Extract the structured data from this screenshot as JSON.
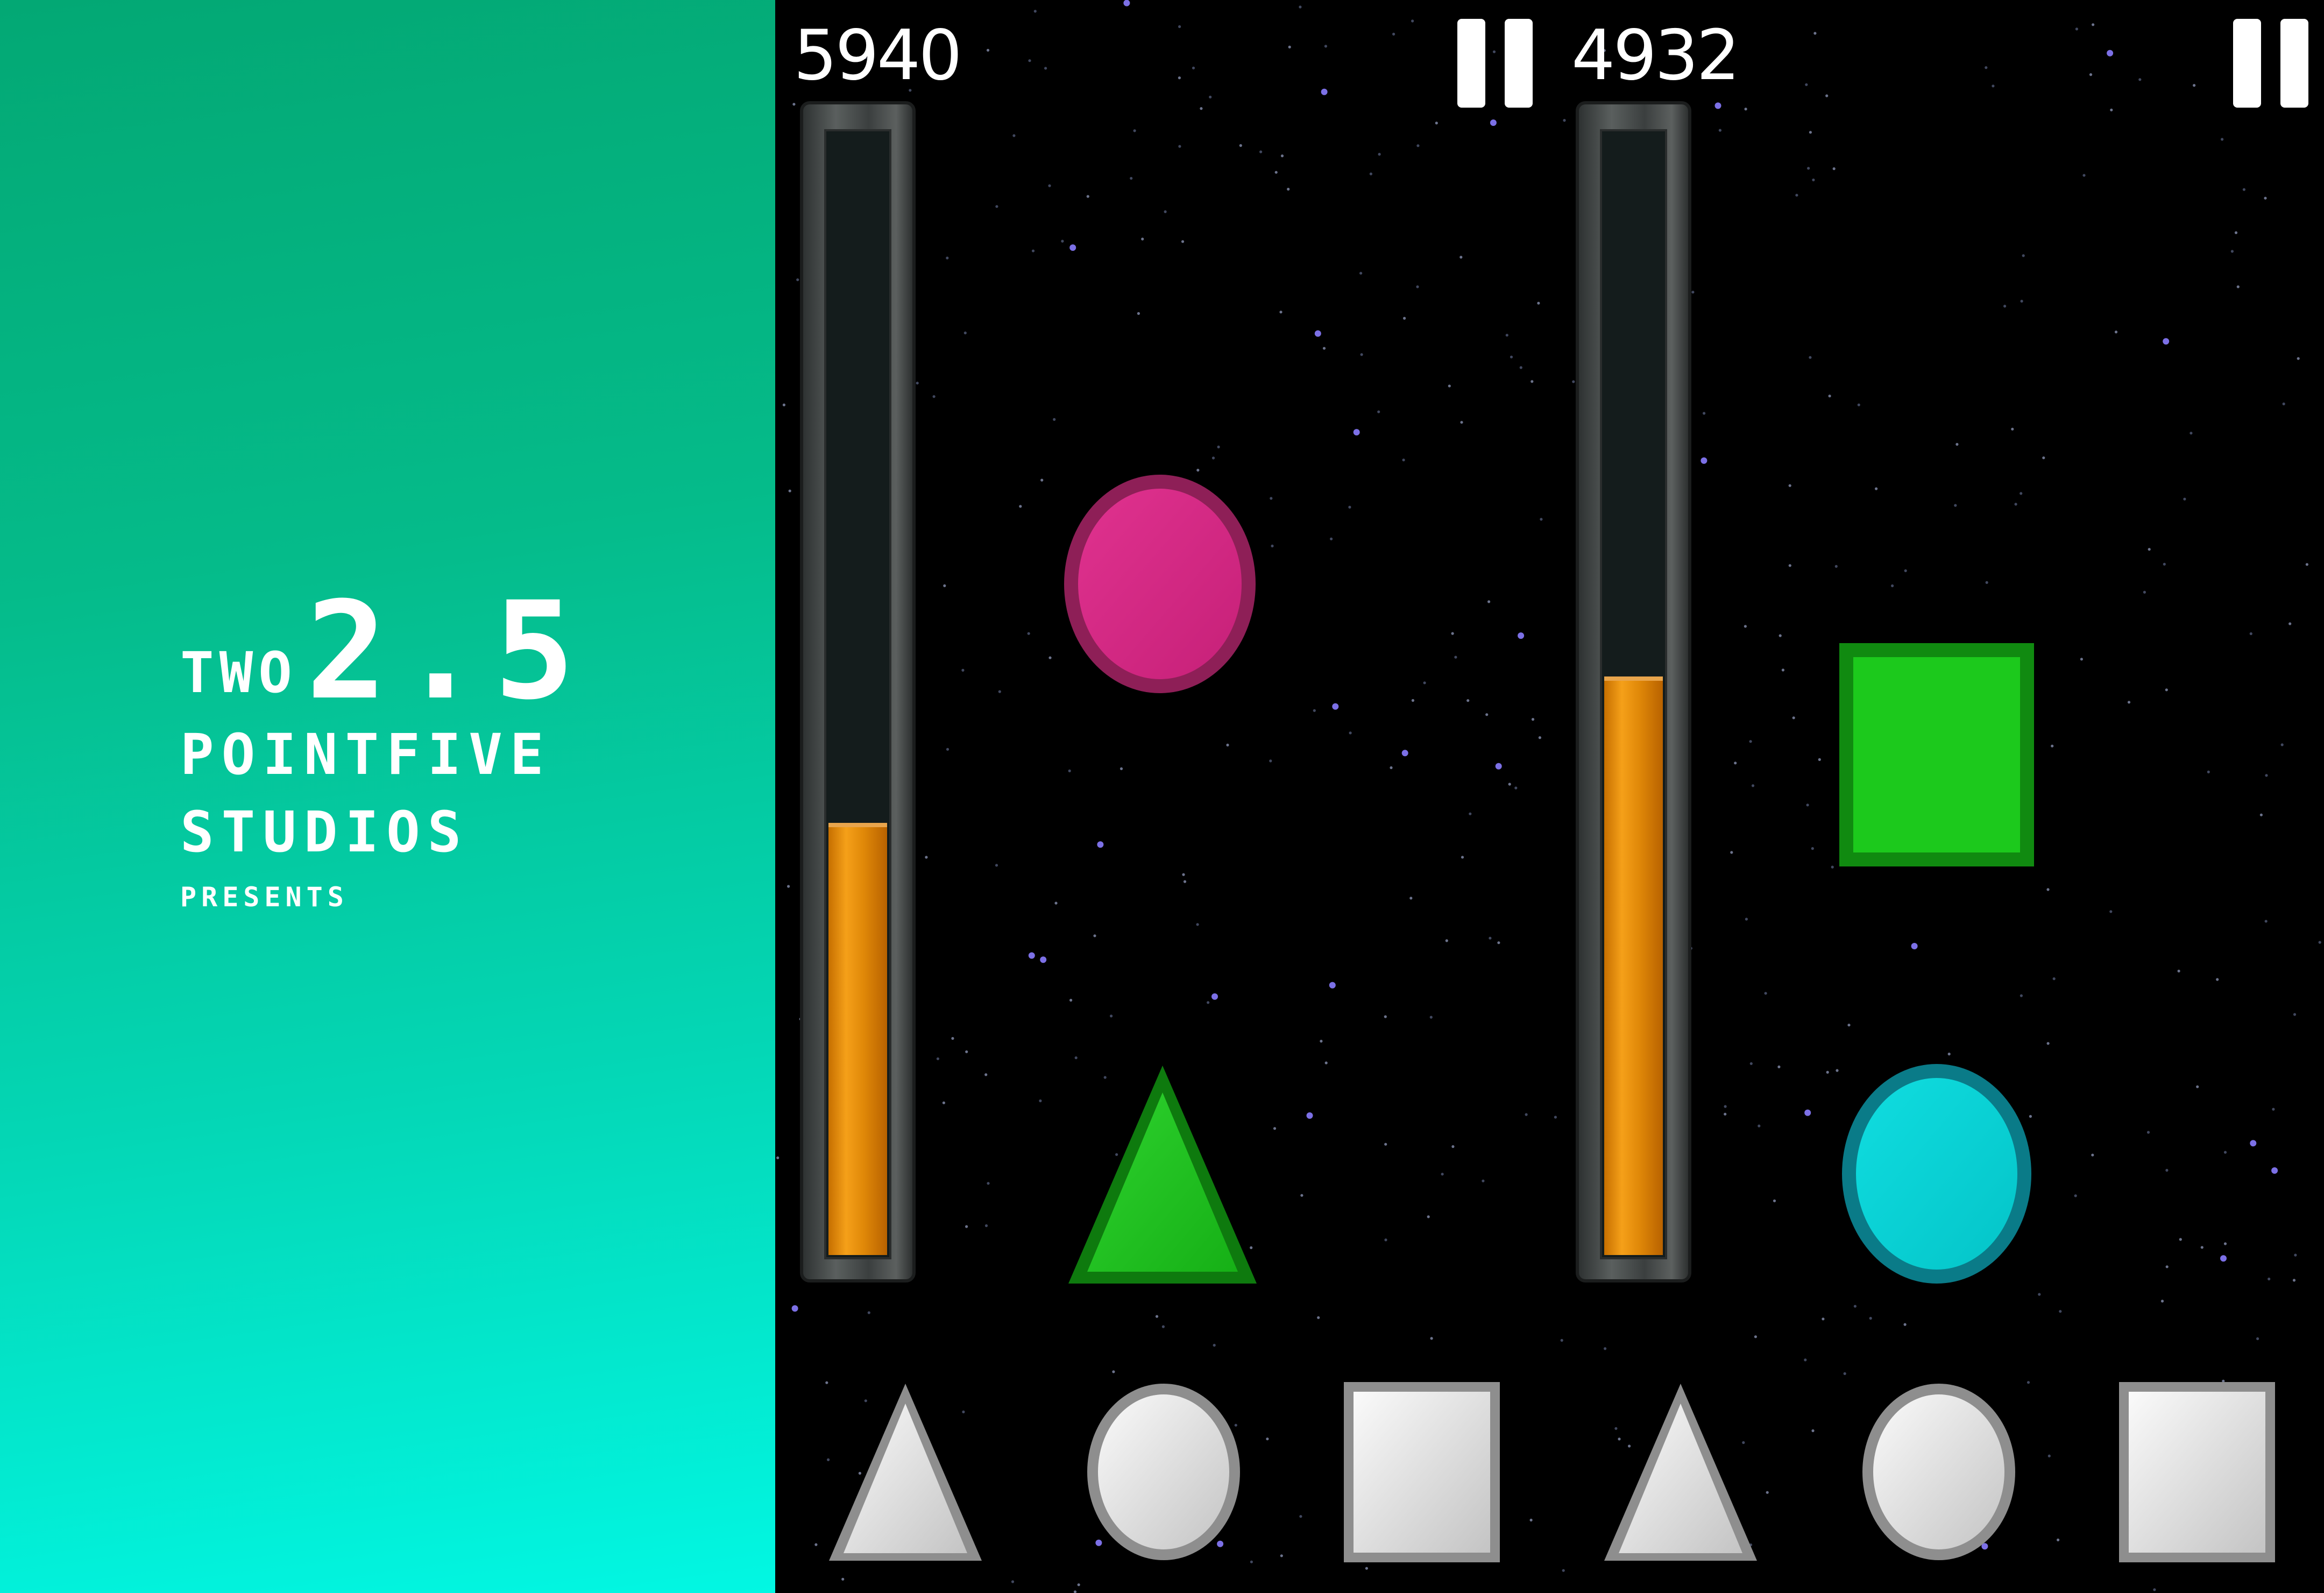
{
  "splash": {
    "logo": {
      "two": "TWO",
      "mark": "2.5",
      "pointfive": "POINTFIVE",
      "studios": "STUDIOS",
      "presents": "PRESENTS"
    },
    "colors": {
      "top": "#03a874",
      "bottom": "#02f7e3"
    }
  },
  "game": {
    "players": [
      {
        "score": "5940",
        "meter_level": 0.38,
        "falling_shapes": [
          "circle-magenta",
          "triangle-green"
        ],
        "buttons": [
          "triangle",
          "circle",
          "square"
        ]
      },
      {
        "score": "4932",
        "meter_level": 0.51,
        "falling_shapes": [
          "square-green",
          "circle-cyan"
        ],
        "buttons": [
          "triangle",
          "circle",
          "square"
        ]
      }
    ],
    "colors": {
      "meter_fill": "#f09a12",
      "magenta": "#d22a84",
      "green": "#1ec41e",
      "cyan": "#06d3d6",
      "button": "#e2e2e2"
    }
  }
}
